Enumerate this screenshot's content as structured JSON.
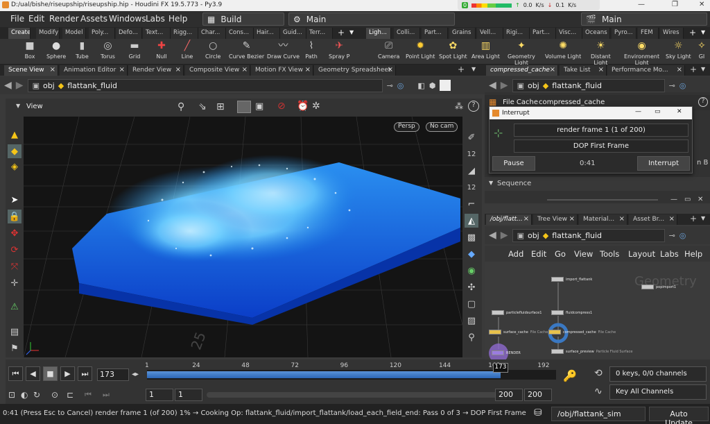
{
  "window": {
    "title": "D:/ual/bishe/riseupship/riseupship.hip - Houdini FX 19.5.773 - Py3.9",
    "net_up": "0.0",
    "net_down": "0.1",
    "net_unit": "K/s",
    "net_pct": "0"
  },
  "menu": [
    "File",
    "Edit",
    "Render",
    "Assets",
    "Windows",
    "Labs",
    "Help"
  ],
  "desktop_left": {
    "label": "Build"
  },
  "desktop_mid": {
    "label": "Main"
  },
  "desktop_right": {
    "label": "Main"
  },
  "shelf_tabs_left": [
    "Create",
    "Modify",
    "Model",
    "Poly...",
    "Defo...",
    "Text...",
    "Rigg...",
    "Char...",
    "Cons...",
    "Hair...",
    "Guid...",
    "Terr..."
  ],
  "shelf_tabs_right": [
    "Ligh...",
    "Colli...",
    "Part...",
    "Grains",
    "Vell...",
    "Rigi...",
    "Part...",
    "Visc...",
    "Oceans",
    "Pyro...",
    "FEM",
    "Wires"
  ],
  "shelf_tools_left": [
    {
      "label": "Box",
      "icon": "box-icon"
    },
    {
      "label": "Sphere",
      "icon": "sphere-icon"
    },
    {
      "label": "Tube",
      "icon": "tube-icon"
    },
    {
      "label": "Torus",
      "icon": "torus-icon"
    },
    {
      "label": "Grid",
      "icon": "grid-icon"
    },
    {
      "label": "Null",
      "icon": "null-icon"
    },
    {
      "label": "Line",
      "icon": "line-icon"
    },
    {
      "label": "Circle",
      "icon": "circle-icon"
    },
    {
      "label": "Curve Bezier",
      "icon": "curve-bezier-icon"
    },
    {
      "label": "Draw Curve",
      "icon": "draw-curve-icon"
    },
    {
      "label": "Path",
      "icon": "path-icon"
    },
    {
      "label": "Spray P",
      "icon": "spray-paint-icon"
    }
  ],
  "shelf_tools_right": [
    {
      "label": "Camera",
      "icon": "camera-icon"
    },
    {
      "label": "Point Light",
      "icon": "point-light-icon"
    },
    {
      "label": "Spot Light",
      "icon": "spot-light-icon"
    },
    {
      "label": "Area Light",
      "icon": "area-light-icon"
    },
    {
      "label": "Geometry\nLight",
      "icon": "geometry-light-icon"
    },
    {
      "label": "Volume Light",
      "icon": "volume-light-icon"
    },
    {
      "label": "Distant\nLight",
      "icon": "distant-light-icon"
    },
    {
      "label": "Environment\nLight",
      "icon": "environment-light-icon"
    },
    {
      "label": "Sky Light",
      "icon": "sky-light-icon"
    },
    {
      "label": "GI",
      "icon": "gi-light-icon"
    }
  ],
  "left_pane_tabs": [
    "Scene View",
    "Animation Editor",
    "Render View",
    "Composite View",
    "Motion FX View",
    "Geometry Spreadsheet"
  ],
  "right_top_tabs": [
    "compressed_cache",
    "Take List",
    "Performance Mo..."
  ],
  "right_bottom_tabs": [
    "/obj/flatt...",
    "Tree View",
    "Material...",
    "Asset Br..."
  ],
  "path": {
    "context": "obj",
    "node": "flattank_fluid"
  },
  "viewport": {
    "title": "View",
    "persp": "Persp",
    "cam": "No cam",
    "grid_number": "25"
  },
  "right_toolbar": {
    "num1": "12",
    "num2": "12"
  },
  "parm_pane": {
    "header": "File Cache",
    "header_value": "compressed_cache",
    "sequence": "Sequence",
    "side_label": "n B"
  },
  "interrupt": {
    "title": "Interrupt",
    "frame": "render frame 1 (1 of 200)",
    "op": "DOP First Frame",
    "pause": "Pause",
    "time": "0:41",
    "interrupt": "Interrupt"
  },
  "net_menu": [
    "Add",
    "Edit",
    "Go",
    "View",
    "Tools",
    "Layout",
    "Labs",
    "Help"
  ],
  "net_watermark": "Geometry",
  "nodes": [
    {
      "name": "import_flattank",
      "sub": ""
    },
    {
      "name": "popimport1",
      "sub": ""
    },
    {
      "name": "particlefluidsurface1",
      "sub": ""
    },
    {
      "name": "fluidcompress1",
      "sub": ""
    },
    {
      "name": "surface_cache",
      "sub": "File Cache"
    },
    {
      "name": "compressed_cache",
      "sub": "File Cache"
    },
    {
      "name": "surface_preview",
      "sub": "Particle Fluid Surface"
    },
    {
      "name": "RENDER",
      "sub": ""
    }
  ],
  "timeline": {
    "current": "173",
    "ticks": [
      "1",
      "24",
      "48",
      "72",
      "96",
      "120",
      "144",
      "168",
      "192"
    ],
    "start": "1",
    "start2": "1",
    "end": "200",
    "end2": "200",
    "progress": 0.865
  },
  "keys": {
    "channels": "0 keys, 0/0 channels",
    "key_all": "Key All Channels"
  },
  "status": {
    "message": "0:41 (Press Esc to Cancel) render frame 1 (of 200) 1% → Cooking Op:  flattank_fluid/import_flattank/load_each_field_end: Pass 0 of 3 → DOP First Frame",
    "path": "/obj/flattank_sim",
    "update": "Auto Update"
  }
}
